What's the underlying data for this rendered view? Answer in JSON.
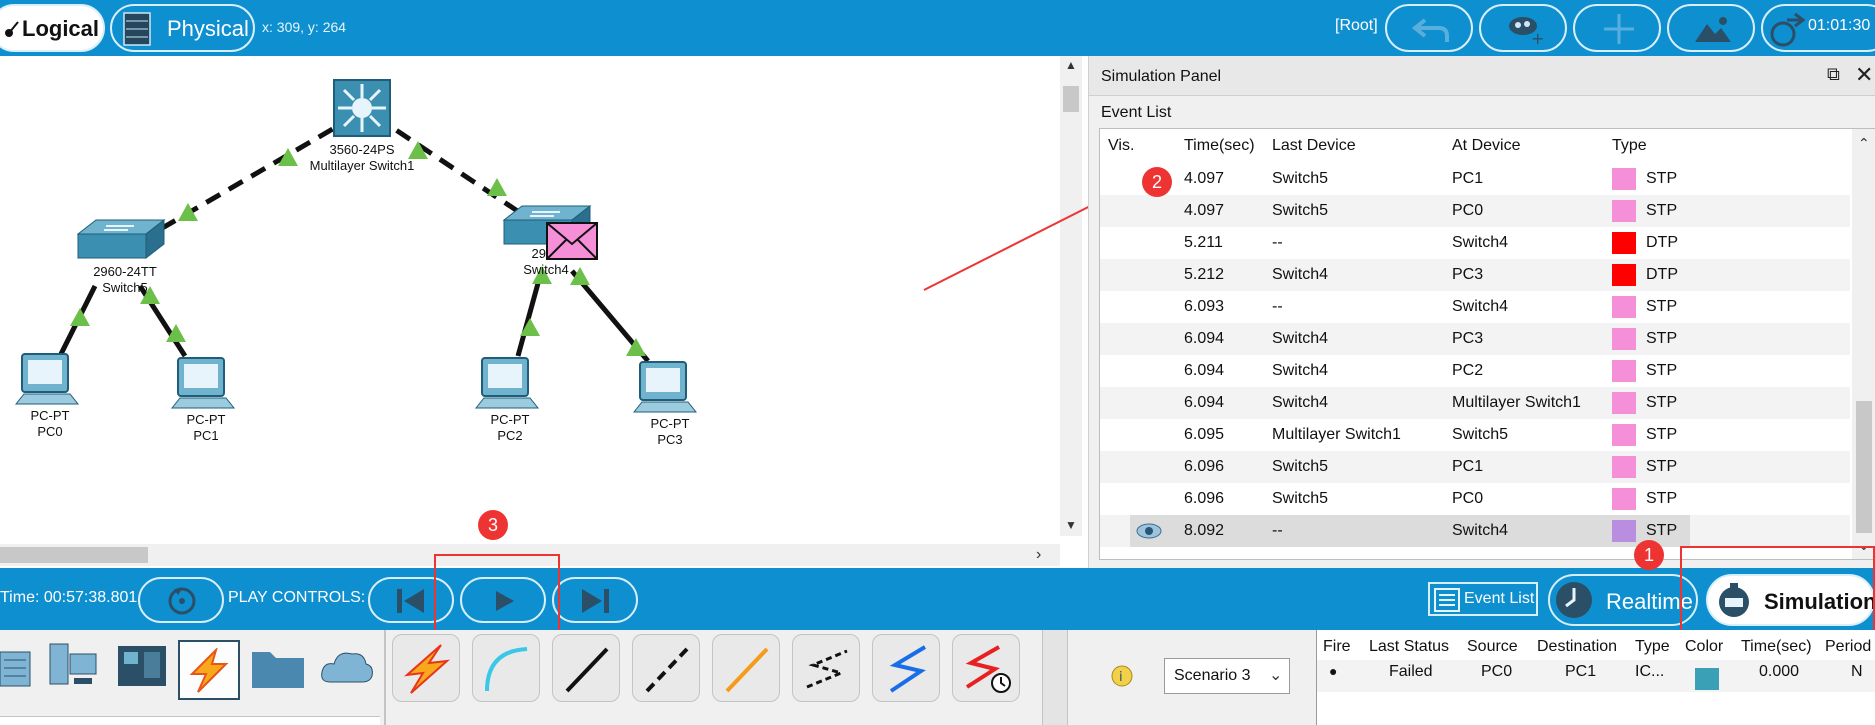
{
  "topbar": {
    "logical_tab": "Logical",
    "physical_tab": "Physical",
    "coordinates": "x: 309, y: 264",
    "root_label": "[Root]",
    "clock": "01:01:30"
  },
  "topology": {
    "devices": [
      {
        "model": "3560-24PS",
        "name": "Multilayer Switch1"
      },
      {
        "model": "2960-24TT",
        "name": "Switch5"
      },
      {
        "model": "2960",
        "name": "Switch4"
      },
      {
        "model": "PC-PT",
        "name": "PC0"
      },
      {
        "model": "PC-PT",
        "name": "PC1"
      },
      {
        "model": "PC-PT",
        "name": "PC2"
      },
      {
        "model": "PC-PT",
        "name": "PC3"
      }
    ]
  },
  "sim_panel": {
    "title": "Simulation Panel",
    "event_list_label": "Event List",
    "columns": [
      "Vis.",
      "Time(sec)",
      "Last Device",
      "At Device",
      "Type"
    ],
    "rows": [
      {
        "time": "4.097",
        "last": "Switch5",
        "at": "PC1",
        "color": "#f48fd8",
        "type": "STP"
      },
      {
        "time": "4.097",
        "last": "Switch5",
        "at": "PC0",
        "color": "#f48fd8",
        "type": "STP"
      },
      {
        "time": "5.211",
        "last": "--",
        "at": "Switch4",
        "color": "#ff0000",
        "type": "DTP"
      },
      {
        "time": "5.212",
        "last": "Switch4",
        "at": "PC3",
        "color": "#ff0000",
        "type": "DTP"
      },
      {
        "time": "6.093",
        "last": "--",
        "at": "Switch4",
        "color": "#f48fd8",
        "type": "STP"
      },
      {
        "time": "6.094",
        "last": "Switch4",
        "at": "PC3",
        "color": "#f48fd8",
        "type": "STP"
      },
      {
        "time": "6.094",
        "last": "Switch4",
        "at": "PC2",
        "color": "#f48fd8",
        "type": "STP"
      },
      {
        "time": "6.094",
        "last": "Switch4",
        "at": "Multilayer Switch1",
        "color": "#f48fd8",
        "type": "STP"
      },
      {
        "time": "6.095",
        "last": "Multilayer Switch1",
        "at": "Switch5",
        "color": "#f48fd8",
        "type": "STP"
      },
      {
        "time": "6.096",
        "last": "Switch5",
        "at": "PC1",
        "color": "#f48fd8",
        "type": "STP"
      },
      {
        "time": "6.096",
        "last": "Switch5",
        "at": "PC0",
        "color": "#f48fd8",
        "type": "STP"
      },
      {
        "time": "8.092",
        "last": "--",
        "at": "Switch4",
        "color": "#b98ee0",
        "type": "STP"
      }
    ]
  },
  "playbar": {
    "time": "Time: 00:57:38.801",
    "play_controls": "PLAY CONTROLS:",
    "event_list_button": "Event List",
    "realtime": "Realtime",
    "simulation": "Simulation"
  },
  "pdu": {
    "scenario": "Scenario 3",
    "columns": [
      "Fire",
      "Last Status",
      "Source",
      "Destination",
      "Type",
      "Color",
      "Time(sec)",
      "Period"
    ],
    "row": {
      "status": "Failed",
      "source": "PC0",
      "destination": "PC1",
      "type": "IC...",
      "color": "#3aa0b6",
      "time": "0.000",
      "period": "N"
    }
  },
  "annotations": {
    "one": "1",
    "two": "2",
    "three": "3"
  }
}
